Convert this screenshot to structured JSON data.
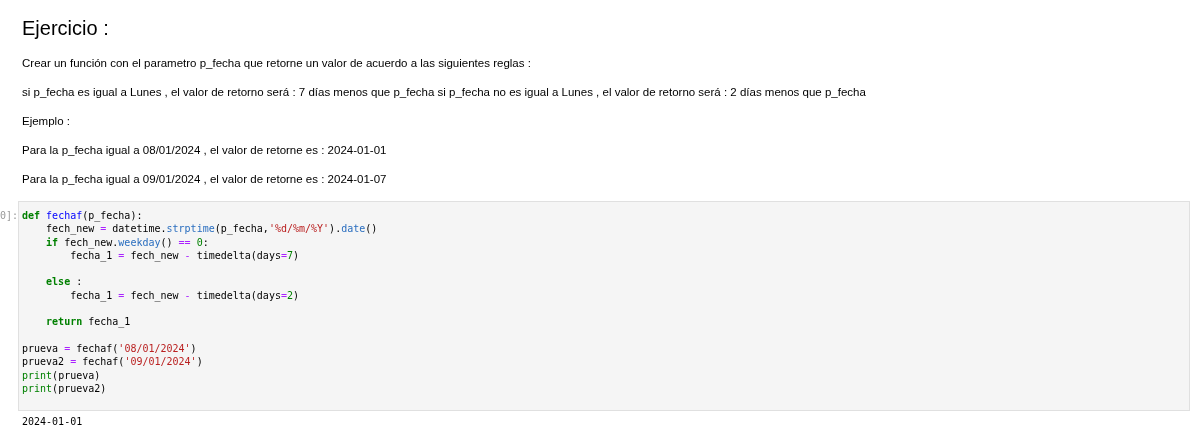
{
  "markdown": {
    "heading": "Ejercicio :",
    "paragraphs": [
      "Crear un función con el parametro p_fecha que retorne un valor de acuerdo a las siguientes reglas :",
      "si p_fecha es igual a Lunes , el valor de retorno será : 7 días menos que p_fecha si p_fecha no es igual a Lunes , el valor de retorno será : 2 días menos que p_fecha",
      "Ejemplo :",
      "Para la p_fecha igual a 08/01/2024 , el valor de retorne es : 2024-01-01",
      "Para la p_fecha igual a 09/01/2024 , el valor de retorne es : 2024-01-07"
    ]
  },
  "code_cell": {
    "prompt": "0]:",
    "blocks": [
      [
        [
          {
            "kind": "keyword",
            "text": "def "
          },
          {
            "kind": "defname",
            "text": "fechaf"
          },
          {
            "kind": "plain",
            "text": "(p_fecha):"
          }
        ],
        [
          {
            "kind": "plain",
            "text": "    fech_new "
          },
          {
            "kind": "operator",
            "text": "="
          },
          {
            "kind": "plain",
            "text": " datetime."
          },
          {
            "kind": "method",
            "text": "strptime"
          },
          {
            "kind": "plain",
            "text": "(p_fecha,"
          },
          {
            "kind": "string",
            "text": "'%d/%m/%Y'"
          },
          {
            "kind": "plain",
            "text": ")."
          },
          {
            "kind": "method",
            "text": "date"
          },
          {
            "kind": "plain",
            "text": "()"
          }
        ],
        [
          {
            "kind": "keyword",
            "text": "    if"
          },
          {
            "kind": "plain",
            "text": " fech_new."
          },
          {
            "kind": "method",
            "text": "weekday"
          },
          {
            "kind": "plain",
            "text": "() "
          },
          {
            "kind": "operator",
            "text": "=="
          },
          {
            "kind": "number",
            "text": " 0"
          },
          {
            "kind": "plain",
            "text": ":"
          }
        ],
        [
          {
            "kind": "plain",
            "text": "        fecha_1 "
          },
          {
            "kind": "operator",
            "text": "="
          },
          {
            "kind": "plain",
            "text": " fech_new "
          },
          {
            "kind": "operator",
            "text": "-"
          },
          {
            "kind": "plain",
            "text": " timedelta(days"
          },
          {
            "kind": "operator",
            "text": "="
          },
          {
            "kind": "number",
            "text": "7"
          },
          {
            "kind": "plain",
            "text": ")"
          }
        ]
      ],
      [
        [
          {
            "kind": "keyword",
            "text": "    else"
          },
          {
            "kind": "plain",
            "text": " :"
          }
        ],
        [
          {
            "kind": "plain",
            "text": "        fecha_1 "
          },
          {
            "kind": "operator",
            "text": "="
          },
          {
            "kind": "plain",
            "text": " fech_new "
          },
          {
            "kind": "operator",
            "text": "-"
          },
          {
            "kind": "plain",
            "text": " timedelta(days"
          },
          {
            "kind": "operator",
            "text": "="
          },
          {
            "kind": "number",
            "text": "2"
          },
          {
            "kind": "plain",
            "text": ")"
          }
        ]
      ],
      [
        [
          {
            "kind": "keyword",
            "text": "    return"
          },
          {
            "kind": "plain",
            "text": " fecha_1"
          }
        ]
      ],
      [
        [
          {
            "kind": "plain",
            "text": "prueva "
          },
          {
            "kind": "operator",
            "text": "="
          },
          {
            "kind": "plain",
            "text": " fechaf("
          },
          {
            "kind": "string",
            "text": "'08/01/2024'"
          },
          {
            "kind": "plain",
            "text": ")"
          }
        ],
        [
          {
            "kind": "plain",
            "text": "prueva2 "
          },
          {
            "kind": "operator",
            "text": "="
          },
          {
            "kind": "plain",
            "text": " fechaf("
          },
          {
            "kind": "string",
            "text": "'09/01/2024'"
          },
          {
            "kind": "plain",
            "text": ")"
          }
        ],
        [
          {
            "kind": "builtin",
            "text": "print"
          },
          {
            "kind": "plain",
            "text": "(prueva)"
          }
        ],
        [
          {
            "kind": "builtin",
            "text": "print"
          },
          {
            "kind": "plain",
            "text": "(prueva2)"
          }
        ]
      ]
    ],
    "output": "2024-01-01"
  }
}
